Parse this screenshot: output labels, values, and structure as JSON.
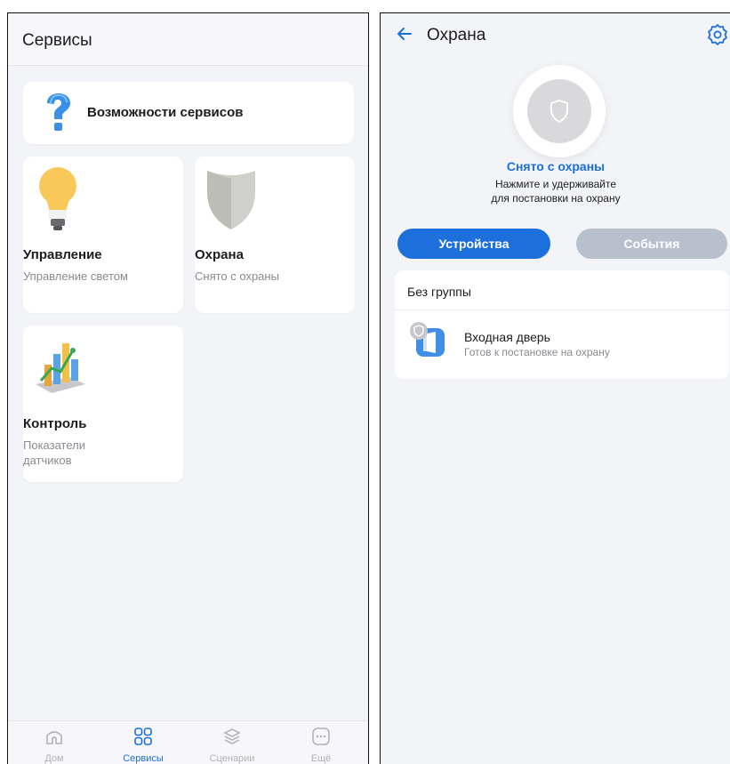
{
  "left_screen": {
    "title": "Сервисы",
    "feature_card": {
      "label": "Возможности сервисов",
      "icon": "question-icon"
    },
    "tiles": [
      {
        "title": "Управление",
        "subtitle": "Управление светом",
        "icon": "light-bulb-icon"
      },
      {
        "title": "Охрана",
        "subtitle": "Снято с охраны",
        "icon": "shield-icon"
      },
      {
        "title": "Контроль",
        "subtitle": "Показатели датчиков",
        "icon": "chart-icon"
      }
    ],
    "tabbar": [
      {
        "label": "Дом",
        "icon": "home-icon"
      },
      {
        "label": "Сервисы",
        "icon": "grid-icon"
      },
      {
        "label": "Сценарии",
        "icon": "layers-icon"
      },
      {
        "label": "Ещё",
        "icon": "more-icon"
      }
    ],
    "active_tab": "Сервисы"
  },
  "right_screen": {
    "title": "Охрана",
    "arm_status": "Снято с охраны",
    "arm_hint_1": "Нажмите и удерживайте",
    "arm_hint_2": "для постановки на охрану",
    "tabs": [
      "Устройства",
      "События"
    ],
    "active_tab": "Устройства",
    "group": {
      "title": "Без группы",
      "devices": [
        {
          "name": "Входная дверь",
          "status": "Готов к постановке на охрану",
          "icon": "door-sensor-icon"
        }
      ]
    }
  },
  "colors": {
    "accent": "#1d6fdb",
    "inactive_tab": "#b7c0cc",
    "background": "#f3f4f7",
    "muted_text": "#8a8a90"
  }
}
